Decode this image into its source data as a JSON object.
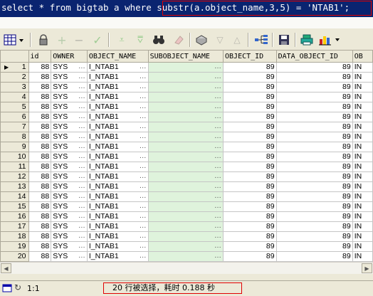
{
  "sql_editor": {
    "line_text": "select * from bigtab a where substr(a.object_name,3,5) = 'NTAB1';"
  },
  "toolbar": {
    "icons": [
      "grid-menu",
      "lock",
      "add-record",
      "delete-record",
      "post-edit",
      "clear-filter",
      "select-all",
      "find",
      "clear",
      "export",
      "sort-desc",
      "sort-asc",
      "query-plan",
      "save",
      "print",
      "chart"
    ]
  },
  "grid": {
    "columns": [
      "",
      "id",
      "OWNER",
      "OBJECT_NAME",
      "SUBOBJECT_NAME",
      "OBJECT_ID",
      "DATA_OBJECT_ID",
      "OBJECT_TYPE"
    ],
    "column_partial": "OB",
    "rows": [
      {
        "n": "1",
        "id": "88",
        "owner": "SYS",
        "object_name": "I_NTAB1",
        "subobject_name": "",
        "object_id": "89",
        "data_object_id": "89",
        "type": "IN"
      },
      {
        "n": "2",
        "id": "88",
        "owner": "SYS",
        "object_name": "I_NTAB1",
        "subobject_name": "",
        "object_id": "89",
        "data_object_id": "89",
        "type": "IN"
      },
      {
        "n": "3",
        "id": "88",
        "owner": "SYS",
        "object_name": "I_NTAB1",
        "subobject_name": "",
        "object_id": "89",
        "data_object_id": "89",
        "type": "IN"
      },
      {
        "n": "4",
        "id": "88",
        "owner": "SYS",
        "object_name": "I_NTAB1",
        "subobject_name": "",
        "object_id": "89",
        "data_object_id": "89",
        "type": "IN"
      },
      {
        "n": "5",
        "id": "88",
        "owner": "SYS",
        "object_name": "I_NTAB1",
        "subobject_name": "",
        "object_id": "89",
        "data_object_id": "89",
        "type": "IN"
      },
      {
        "n": "6",
        "id": "88",
        "owner": "SYS",
        "object_name": "I_NTAB1",
        "subobject_name": "",
        "object_id": "89",
        "data_object_id": "89",
        "type": "IN"
      },
      {
        "n": "7",
        "id": "88",
        "owner": "SYS",
        "object_name": "I_NTAB1",
        "subobject_name": "",
        "object_id": "89",
        "data_object_id": "89",
        "type": "IN"
      },
      {
        "n": "8",
        "id": "88",
        "owner": "SYS",
        "object_name": "I_NTAB1",
        "subobject_name": "",
        "object_id": "89",
        "data_object_id": "89",
        "type": "IN"
      },
      {
        "n": "9",
        "id": "88",
        "owner": "SYS",
        "object_name": "I_NTAB1",
        "subobject_name": "",
        "object_id": "89",
        "data_object_id": "89",
        "type": "IN"
      },
      {
        "n": "10",
        "id": "88",
        "owner": "SYS",
        "object_name": "I_NTAB1",
        "subobject_name": "",
        "object_id": "89",
        "data_object_id": "89",
        "type": "IN"
      },
      {
        "n": "11",
        "id": "88",
        "owner": "SYS",
        "object_name": "I_NTAB1",
        "subobject_name": "",
        "object_id": "89",
        "data_object_id": "89",
        "type": "IN"
      },
      {
        "n": "12",
        "id": "88",
        "owner": "SYS",
        "object_name": "I_NTAB1",
        "subobject_name": "",
        "object_id": "89",
        "data_object_id": "89",
        "type": "IN"
      },
      {
        "n": "13",
        "id": "88",
        "owner": "SYS",
        "object_name": "I_NTAB1",
        "subobject_name": "",
        "object_id": "89",
        "data_object_id": "89",
        "type": "IN"
      },
      {
        "n": "14",
        "id": "88",
        "owner": "SYS",
        "object_name": "I_NTAB1",
        "subobject_name": "",
        "object_id": "89",
        "data_object_id": "89",
        "type": "IN"
      },
      {
        "n": "15",
        "id": "88",
        "owner": "SYS",
        "object_name": "I_NTAB1",
        "subobject_name": "",
        "object_id": "89",
        "data_object_id": "89",
        "type": "IN"
      },
      {
        "n": "16",
        "id": "88",
        "owner": "SYS",
        "object_name": "I_NTAB1",
        "subobject_name": "",
        "object_id": "89",
        "data_object_id": "89",
        "type": "IN"
      },
      {
        "n": "17",
        "id": "88",
        "owner": "SYS",
        "object_name": "I_NTAB1",
        "subobject_name": "",
        "object_id": "89",
        "data_object_id": "89",
        "type": "IN"
      },
      {
        "n": "18",
        "id": "88",
        "owner": "SYS",
        "object_name": "I_NTAB1",
        "subobject_name": "",
        "object_id": "89",
        "data_object_id": "89",
        "type": "IN"
      },
      {
        "n": "19",
        "id": "88",
        "owner": "SYS",
        "object_name": "I_NTAB1",
        "subobject_name": "",
        "object_id": "89",
        "data_object_id": "89",
        "type": "IN"
      },
      {
        "n": "20",
        "id": "88",
        "owner": "SYS",
        "object_name": "I_NTAB1",
        "subobject_name": "",
        "object_id": "89",
        "data_object_id": "89",
        "type": "IN"
      }
    ]
  },
  "status_bar": {
    "position": "1:1",
    "message": "20 行被选择，耗时 0.188 秒"
  },
  "colors": {
    "sql_bg": "#0a2470",
    "highlight_border": "#e00000",
    "green_cell": "#dff3dc"
  }
}
